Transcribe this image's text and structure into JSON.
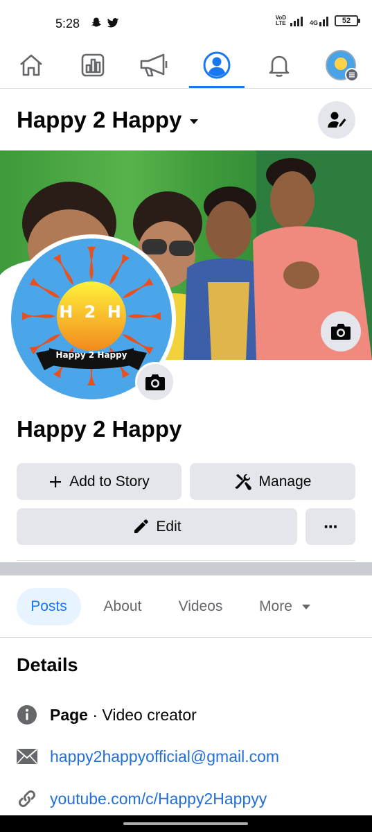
{
  "status_bar": {
    "time": "5:28",
    "volte_line1": "VoD",
    "volte_line2": "LTE",
    "network": "4G",
    "battery": "52"
  },
  "nav": {
    "items": [
      {
        "name": "home-icon"
      },
      {
        "name": "insights-icon"
      },
      {
        "name": "megaphone-icon"
      },
      {
        "name": "profile-icon",
        "active": true
      },
      {
        "name": "bell-icon"
      },
      {
        "name": "page-avatar-menu-icon"
      }
    ],
    "accent_color": "#1877f2"
  },
  "header": {
    "title": "Happy 2 Happy"
  },
  "profile": {
    "logo_text": "H 2 H",
    "logo_banner": "Happy 2 Happy",
    "name": "Happy 2 Happy"
  },
  "actions": {
    "add_story": "Add to Story",
    "manage": "Manage",
    "edit": "Edit",
    "more": "···"
  },
  "tabs": [
    {
      "label": "Posts",
      "active": true
    },
    {
      "label": "About"
    },
    {
      "label": "Videos"
    },
    {
      "label": "More"
    }
  ],
  "details": {
    "title": "Details",
    "page_type_bold": "Page",
    "page_type_rest": " · Video creator",
    "email": "happy2happyofficial@gmail.com",
    "youtube": "youtube.com/c/Happy2Happyy"
  }
}
